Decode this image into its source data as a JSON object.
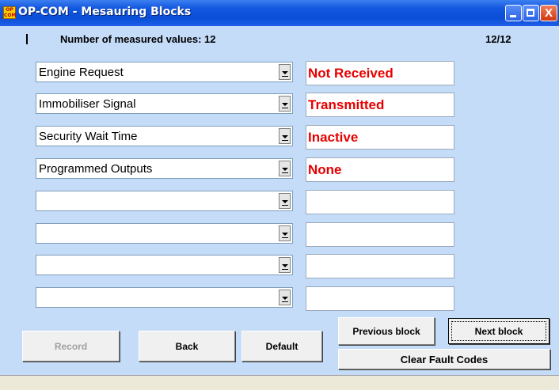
{
  "window": {
    "title": "OP-COM - Mesauring Blocks",
    "icon_text": "OP COM",
    "close_glyph": "X"
  },
  "header": {
    "count_label": "Number of measured values: 12",
    "page_indicator": "12/12"
  },
  "rows": [
    {
      "parameter": "Engine Request",
      "value": "Not Received"
    },
    {
      "parameter": "Immobiliser Signal",
      "value": "Transmitted"
    },
    {
      "parameter": "Security Wait Time",
      "value": "Inactive"
    },
    {
      "parameter": "Programmed Outputs",
      "value": "None"
    },
    {
      "parameter": "",
      "value": ""
    },
    {
      "parameter": "",
      "value": ""
    },
    {
      "parameter": "",
      "value": ""
    },
    {
      "parameter": "",
      "value": ""
    }
  ],
  "buttons": {
    "record": "Record",
    "back": "Back",
    "default": "Default",
    "previous_block": "Previous block",
    "next_block": "Next block",
    "clear_fault_codes": "Clear Fault Codes"
  },
  "colors": {
    "value_text": "#e80000",
    "background": "#c4dcf8"
  }
}
